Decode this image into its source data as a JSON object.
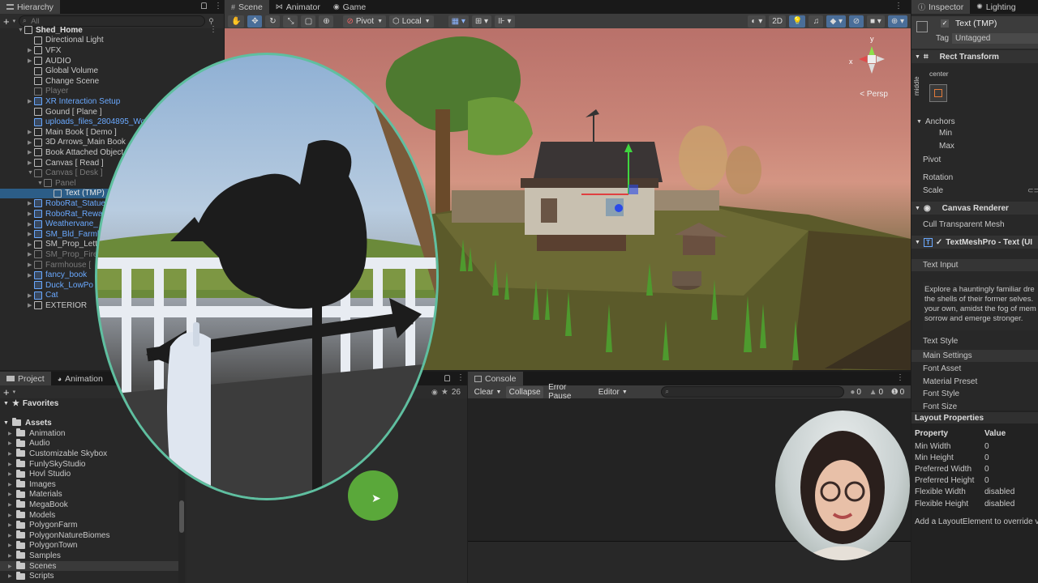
{
  "hierarchy": {
    "tab": "Hierarchy",
    "search_placeholder": "All",
    "items": [
      {
        "label": "Shed_Home",
        "indent": 0,
        "style": "bold",
        "arrow": "▼"
      },
      {
        "label": "Directional Light",
        "indent": 1,
        "style": "",
        "arrow": ""
      },
      {
        "label": "VFX",
        "indent": 1,
        "style": "",
        "arrow": "▶"
      },
      {
        "label": "AUDIO",
        "indent": 1,
        "style": "",
        "arrow": "▶"
      },
      {
        "label": "Global Volume",
        "indent": 1,
        "style": "",
        "arrow": ""
      },
      {
        "label": "Change Scene",
        "indent": 1,
        "style": "",
        "arrow": ""
      },
      {
        "label": "Player",
        "indent": 1,
        "style": "dim",
        "arrow": ""
      },
      {
        "label": "XR Interaction Setup",
        "indent": 1,
        "style": "blue",
        "arrow": "▶"
      },
      {
        "label": "Gound [ Plane ]",
        "indent": 1,
        "style": "",
        "arrow": ""
      },
      {
        "label": "uploads_files_2804895_Wo",
        "indent": 1,
        "style": "blue",
        "arrow": ""
      },
      {
        "label": "Main Book [ Demo ]",
        "indent": 1,
        "style": "",
        "arrow": "▶"
      },
      {
        "label": "3D Arrows_Main Book",
        "indent": 1,
        "style": "",
        "arrow": "▶"
      },
      {
        "label": "Book Attached Object",
        "indent": 1,
        "style": "",
        "arrow": "▶"
      },
      {
        "label": "Canvas [ Read ]",
        "indent": 1,
        "style": "",
        "arrow": "▶"
      },
      {
        "label": "Canvas [ Desk ]",
        "indent": 1,
        "style": "dim",
        "arrow": "▼"
      },
      {
        "label": "Panel",
        "indent": 2,
        "style": "dim",
        "arrow": "▼"
      },
      {
        "label": "Text (TMP)",
        "indent": 3,
        "style": "sel",
        "arrow": ""
      },
      {
        "label": "RoboRat_Statue",
        "indent": 1,
        "style": "blue",
        "arrow": "▶"
      },
      {
        "label": "RoboRat_Rewa",
        "indent": 1,
        "style": "blue",
        "arrow": "▶"
      },
      {
        "label": "Weathervane_",
        "indent": 1,
        "style": "blue",
        "arrow": "▶"
      },
      {
        "label": "SM_Bld_Farmh",
        "indent": 1,
        "style": "blue",
        "arrow": "▶"
      },
      {
        "label": "SM_Prop_Lette",
        "indent": 1,
        "style": "",
        "arrow": "▶"
      },
      {
        "label": "SM_Prop_Fire",
        "indent": 1,
        "style": "dim",
        "arrow": "▶"
      },
      {
        "label": "Farmhouse [",
        "indent": 1,
        "style": "dim",
        "arrow": "▶"
      },
      {
        "label": "fancy_book",
        "indent": 1,
        "style": "blue",
        "arrow": "▶"
      },
      {
        "label": "Duck_LowPo",
        "indent": 1,
        "style": "blue",
        "arrow": ""
      },
      {
        "label": "Cat",
        "indent": 1,
        "style": "blue",
        "arrow": "▶"
      },
      {
        "label": "EXTERIOR",
        "indent": 1,
        "style": "",
        "arrow": "▶"
      }
    ]
  },
  "scene": {
    "tabs": [
      "Scene",
      "Animator",
      "Game"
    ],
    "pivot": "Pivot",
    "local": "Local",
    "mode_2d": "2D",
    "persp": "< Persp",
    "gizmo_x": "x",
    "gizmo_y": "y"
  },
  "project": {
    "tabs": [
      "Project",
      "Animation"
    ],
    "favorites": "Favorites",
    "assets": "Assets",
    "folders": [
      "Animation",
      "Audio",
      "Customizable Skybox",
      "FunlySkyStudio",
      "Hovl Studio",
      "Images",
      "Materials",
      "MegaBook",
      "Models",
      "PolygonFarm",
      "PolygonNatureBiomes",
      "PolygonTown",
      "Samples",
      "Scenes",
      "Scripts"
    ],
    "count": "26"
  },
  "console": {
    "tab": "Console",
    "clear": "Clear",
    "collapse": "Collapse",
    "error_pause": "Error Pause",
    "editor": "Editor",
    "counts": [
      "0",
      "0",
      "0"
    ]
  },
  "inspector": {
    "tabs": [
      "Inspector",
      "Lighting"
    ],
    "object_name": "Text (TMP)",
    "tag_label": "Tag",
    "tag_value": "Untagged",
    "rect_transform": "Rect Transform",
    "anchor_center": "center",
    "anchor_middle": "middle",
    "anchors": "Anchors",
    "min": "Min",
    "max": "Max",
    "pivot": "Pivot",
    "rotation": "Rotation",
    "scale": "Scale",
    "canvas_renderer": "Canvas Renderer",
    "cull": "Cull Transparent Mesh",
    "tmp": "TextMeshPro - Text (UI",
    "text_input": "Text Input",
    "text_body": [
      "Explore a hauntingly familiar dre",
      "the shells of their former selves.",
      "your own, amidst the fog of mem",
      "sorrow and emerge stronger."
    ],
    "text_style": "Text Style",
    "main_settings": "Main Settings",
    "font_asset": "Font Asset",
    "material_preset": "Material Preset",
    "font_style": "Font Style",
    "font_size": "Font Size",
    "layout_props": "Layout Properties",
    "lp_header_prop": "Property",
    "lp_header_value": "Value",
    "layout_rows": [
      {
        "prop": "Min Width",
        "value": "0"
      },
      {
        "prop": "Min Height",
        "value": "0"
      },
      {
        "prop": "Preferred Width",
        "value": "0"
      },
      {
        "prop": "Preferred Height",
        "value": "0"
      },
      {
        "prop": "Flexible Width",
        "value": "disabled"
      },
      {
        "prop": "Flexible Height",
        "value": "disabled"
      }
    ],
    "footer": "Add a LayoutElement to override v"
  },
  "colors": {
    "accent": "#6aa9ff",
    "selection": "#2c5d87",
    "overlay_ring": "#5fbfa0",
    "cursor_circle": "#5aa83a"
  }
}
